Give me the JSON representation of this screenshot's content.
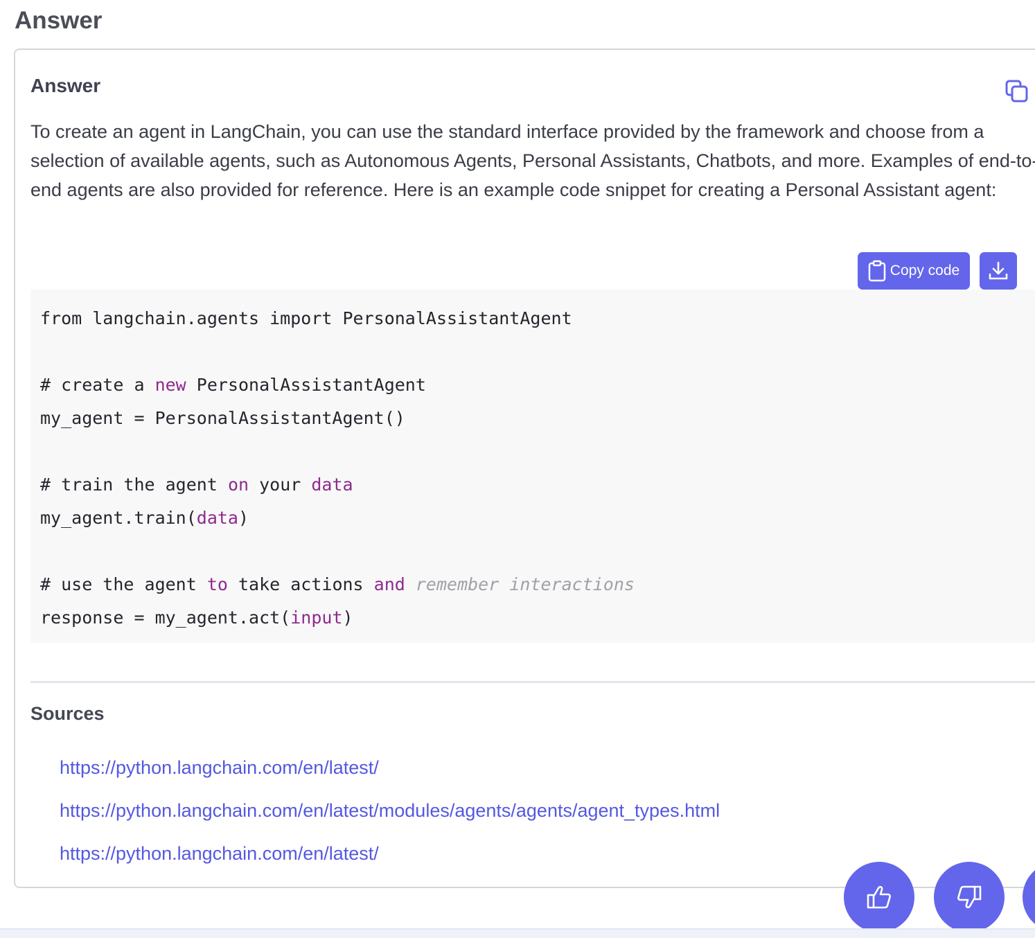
{
  "page": {
    "title": "Answer"
  },
  "answer_card": {
    "title": "Answer",
    "copy_icon": "copy-icon",
    "text": "To create an agent in LangChain, you can use the standard interface provided by the framework and choose from a selection of available agents, such as Autonomous Agents, Personal Assistants, Chatbots, and more. Examples of end-to-end agents are also provided for reference. Here is an example code snippet for creating a Personal Assistant agent:"
  },
  "code_tools": {
    "copy_label": "Copy code",
    "copy_icon": "clipboard-icon",
    "download_icon": "download-icon"
  },
  "code": {
    "line1": "from langchain.agents import PersonalAssistantAgent",
    "line3_a": "# create a ",
    "line3_kw": "new",
    "line3_b": " PersonalAssistantAgent",
    "line4": "my_agent = PersonalAssistantAgent()",
    "line6_a": "# train the agent ",
    "line6_kw1": "on",
    "line6_b": " your ",
    "line6_kw2": "data",
    "line7_a": "my_agent.train(",
    "line7_kw": "data",
    "line7_b": ")",
    "line9_a": "# use the agent ",
    "line9_kw1": "to",
    "line9_b": " take actions ",
    "line9_kw2": "and",
    "line9_c": " ",
    "line9_cm": "remember interactions",
    "line10_a": "response = my_agent.act(",
    "line10_kw": "input",
    "line10_b": ")"
  },
  "sources": {
    "title": "Sources",
    "links": [
      "https://python.langchain.com/en/latest/",
      "https://python.langchain.com/en/latest/modules/agents/agents/agent_types.html",
      "https://python.langchain.com/en/latest/"
    ]
  },
  "feedback": {
    "thumbs_up_icon": "thumbs-up-icon",
    "thumbs_down_icon": "thumbs-down-icon"
  },
  "colors": {
    "accent": "#6366ea",
    "link": "#5458e0",
    "keyword": "#8e2a8e",
    "comment_italic": "#a0a0a8",
    "code_bg": "#f8f8f8"
  }
}
